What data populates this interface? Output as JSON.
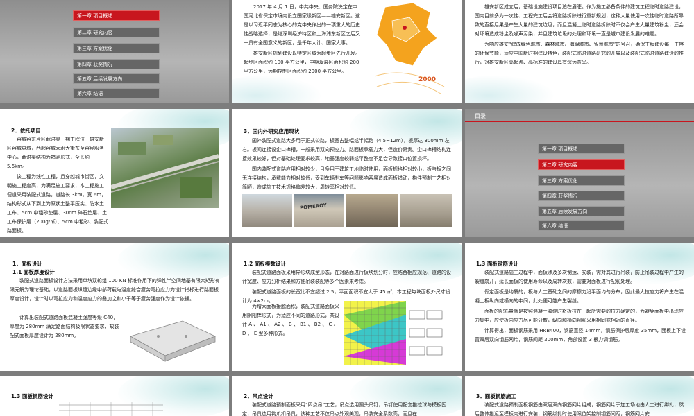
{
  "toc": {
    "items": [
      {
        "label": "第一章 项目概述"
      },
      {
        "label": "第二章 研究内容"
      },
      {
        "label": "第三章 方案优化"
      },
      {
        "label": "第四章 获奖情况"
      },
      {
        "label": "第五章 后续发展方向"
      },
      {
        "label": "第六章 结语"
      }
    ],
    "title": "目录"
  },
  "slide2": {
    "p1": "2017 年 4 月 1 日，中共中央、国务院决定在中国河北省保定市境内设立国家级新区——雄安新区。这是以习近平同志为核心的党中央作出的一项重大的历史性战略选择，是继深圳经济特区和上海浦东新区之后又一具有全国意义的新区，是千年大计、国家大事。",
    "p2": "雄安新区规划建设以特定区域为起步区先行开发。起步区面积约 100 平方公里，中期发展区面积约 200 平方公里，远期控制区面积约 2000 平方公里。",
    "map_label": "2000"
  },
  "slide3": {
    "p1": "雄安新区成立后，基础设施建设项目迫在眉睫。作为施工必备条件的建筑工程临时道路建设，国内目前多为一次性、工程完工后会将道路拆除进行重新规划，这种大量使用一次性临时道路所导致的直接后果是产生大量的建筑垃圾，而且混凝土临时道路拆除时不仅会产生大量建筑粉尘，还会对环境造成粉尘及噪声污染，并且建筑垃圾的处理和环境一直是城市建设发展的难题。",
    "p2": "为响应雄安“建成绿色城市、森林城市、海绵城市、智慧城市”的号召，确保工程建设每一工序的环保节能，适应中国新时期建设特色，装配式临时道路研究的开展以及装配式临时道路建设的推行，对雄安新区高起点、高标准的建设具有深远意义。"
  },
  "slide4": {
    "heading": "2．依托项目",
    "p1": "容城容东片区截洪渠一期工程位于雄安新区容城县城，西起容城大水大街东至容民服务中心，截洪渠结构为箱涵形式，全长约 5.6km。",
    "p2": "该工程为线性工程，且穿越城市街区，文明施工程度高，为满足施工要求，本工程施工便道采用装配式道路，道路长 3km，宽 6m，结构形式从下到上为原状土整平压实、防水土工布、5cm 中粗砂垫层、30cm 碎石垫层、土工布保护层（200g/㎡）、5cm 中粗砂、装配式路面板。"
  },
  "slide5": {
    "heading": "3．国内外研究应用现状",
    "p1": "国外装配式道路大多用于正式公路，板宽占整幅或半幅路（4.5~12m），板厚达 300mm 左右。板间连接设企口榫槽，一般采用双向预应力。路面板承载力大，但造价昂贵。企口榫槽结构连接效果较好，但对基础处理要求较高，地基强度较弱或平整度不足会导致接口位置损坏。",
    "p2": "国内装配式道路应用相对较少，且多用于建筑工地临时使用，面板规格相对较小，板与板之间无连接结构，承载能力相对较低，受到车辆制车等问题影响容易造成面板错动，构件预制工艺相对简陋，造成施工技术规格偏差较大，周转率相对较低。",
    "photo_text": "POMEROY"
  },
  "slide7": {
    "heading": "1．面板设计",
    "sub": "1.1  面板厚度设计",
    "p1": "装配式道路面板设计方法采用单块双轮组 100 KN 标准作用下的弹性半空间地基有限大矩形有限元解为理论基础，以道路面板纵缝边缘中部荷载与温度综合疲劳弯拉应力为设计指标进行路面板厚度设计，设计时以弯拉应力和温度应力的叠加之和小于等于疲劳强度作为设计依据。",
    "p2": "计算出装配式道路面板混凝土强度等级 C40，厚度为 280mm 满足路面结构极限状态要求，故装配式面板厚度设计为 280mm。"
  },
  "slide8": {
    "sub": "1.2  面板模数设计",
    "p1": "装配式道路面板采用异形块成型形态，在对路面进行板块划分时，应结合相应规范、道路的设计宽度、应力分析结果和方便吊装装配等多个因素来考虑。",
    "p2": "装配式道路面板的长宽比不宜超过 2.5，平面面积不宜大于 45 ㎡，本工程每块面板外尺寸设计为 4×2m。",
    "p3": "为增大面板接触面积，装配式道路面板采用阴阳榫形式，为适应不同的道路形式，共设计 A 、 A1 、 A2 、 B 、 B1 、 B2 、 C 、 D 、 E 型多种形式。"
  },
  "slide9": {
    "sub": "1.3  面板钢筋设计",
    "p1": "装配式道路施工过程中，面板涉及多次倒运、安装，需对其进行吊装，防止吊装过程中产生的裂缝崩开，延长面板的使用寿命以及周转次数，需要对面板进行配筋处理。",
    "p2": "假定面板是均质的，板与人工基础之间的摩擦力沿平面均匀分布，因此最大拉应力将产生在混凝土板纵向或横向的中间，此处便可能产生裂缝。",
    "p3": "面板的配筋量就是按照混凝土收缩时将板拉在一起所需要的拉力确定的，为避免面板中出现应力集中，应使板内应力尽可能分散，纵向和横向钢筋采用相同或相近的直径。",
    "p4": "计算得出，面板钢筋采用 HRB400，钢筋直径 14mm，钢筋保护层厚度 35mm，面板上下设置双层双向钢筋网片，钢筋间距 200mm，角部设置 3 根力调钢筋。"
  },
  "slide10": {
    "sub": "1.3  面板钢筋设计"
  },
  "slide11": {
    "heading": "2．吊点设计",
    "p1": "装配式道路预制面板采用“四点吊”工艺，吊点选用圆头吊钉，吊钉使用配套推拉球与模板固定，吊具选用钩爪扣吊具，该种工艺不仅吊点外观美观，吊装安全系数高，而且在"
  },
  "slide12": {
    "heading": "3．面板钢筋施工",
    "p1": "装配式道路预制面板钢筋由双层双向钢筋网片组成，钢筋网片于加工场地由人工进行绑扎，然后整体搬运至模板内进行安装，钢筋绑扎时使用限位架控制钢筋间距，钢筋网片安"
  },
  "slide6": {
    "title": "目录"
  },
  "colors": {
    "active": "#c8161e",
    "button": "#666666",
    "teal": "#7cc8c8",
    "map_orange": "#f4a31e"
  }
}
